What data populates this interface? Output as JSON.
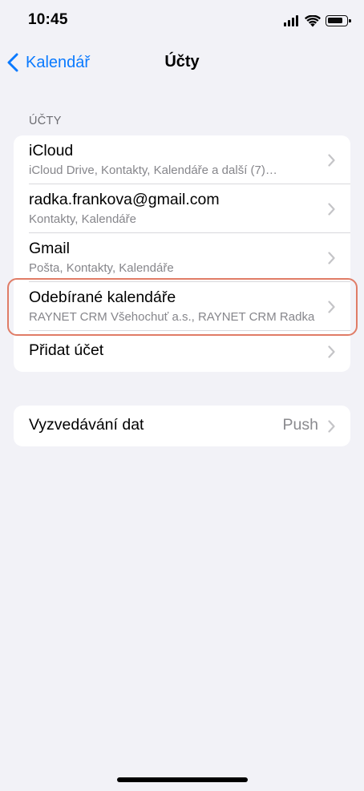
{
  "status_bar": {
    "time": "10:45",
    "signal_icon": "cellular-signal-icon",
    "wifi_icon": "wifi-icon",
    "battery_icon": "battery-icon",
    "battery_level": 0.75
  },
  "nav": {
    "back_label": "Kalendář",
    "title": "Účty",
    "accent_color": "#0a7aff"
  },
  "accounts_section": {
    "header": "ÚČTY",
    "items": [
      {
        "title": "iCloud",
        "subtitle": "iCloud Drive, Kontakty, Kalendáře a další (7)…"
      },
      {
        "title": "radka.frankova@gmail.com",
        "subtitle": "Kontakty, Kalendáře"
      },
      {
        "title": "Gmail",
        "subtitle": "Pošta, Kontakty, Kalendáře"
      },
      {
        "title": "Odebírané kalendáře",
        "subtitle": "RAYNET CRM Všehochuť a.s., RAYNET CRM Radka"
      },
      {
        "title": "Přidat účet"
      }
    ]
  },
  "fetch_section": {
    "title": "Vyzvedávání dat",
    "value": "Push"
  },
  "highlight_color": "#e07c66"
}
